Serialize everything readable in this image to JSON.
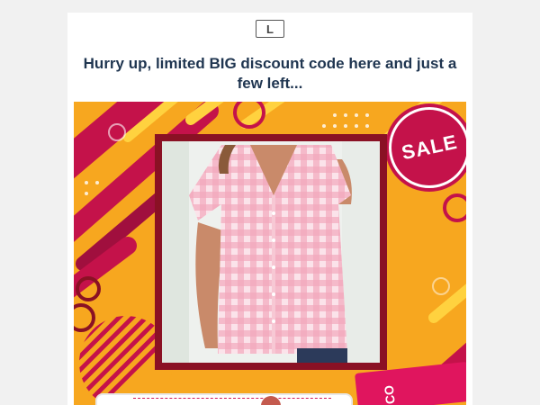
{
  "logo": {
    "letter": "L"
  },
  "headline": "Hurry up, limited BIG discount code here and just a few left...",
  "banner": {
    "badge_text": "SALE",
    "coupon_text": "CO",
    "colors": {
      "background": "#f7a71f",
      "accent": "#c4124a",
      "frame": "#8a1124"
    }
  },
  "product_image": {
    "icon": "product-photo",
    "description_visible": false
  }
}
